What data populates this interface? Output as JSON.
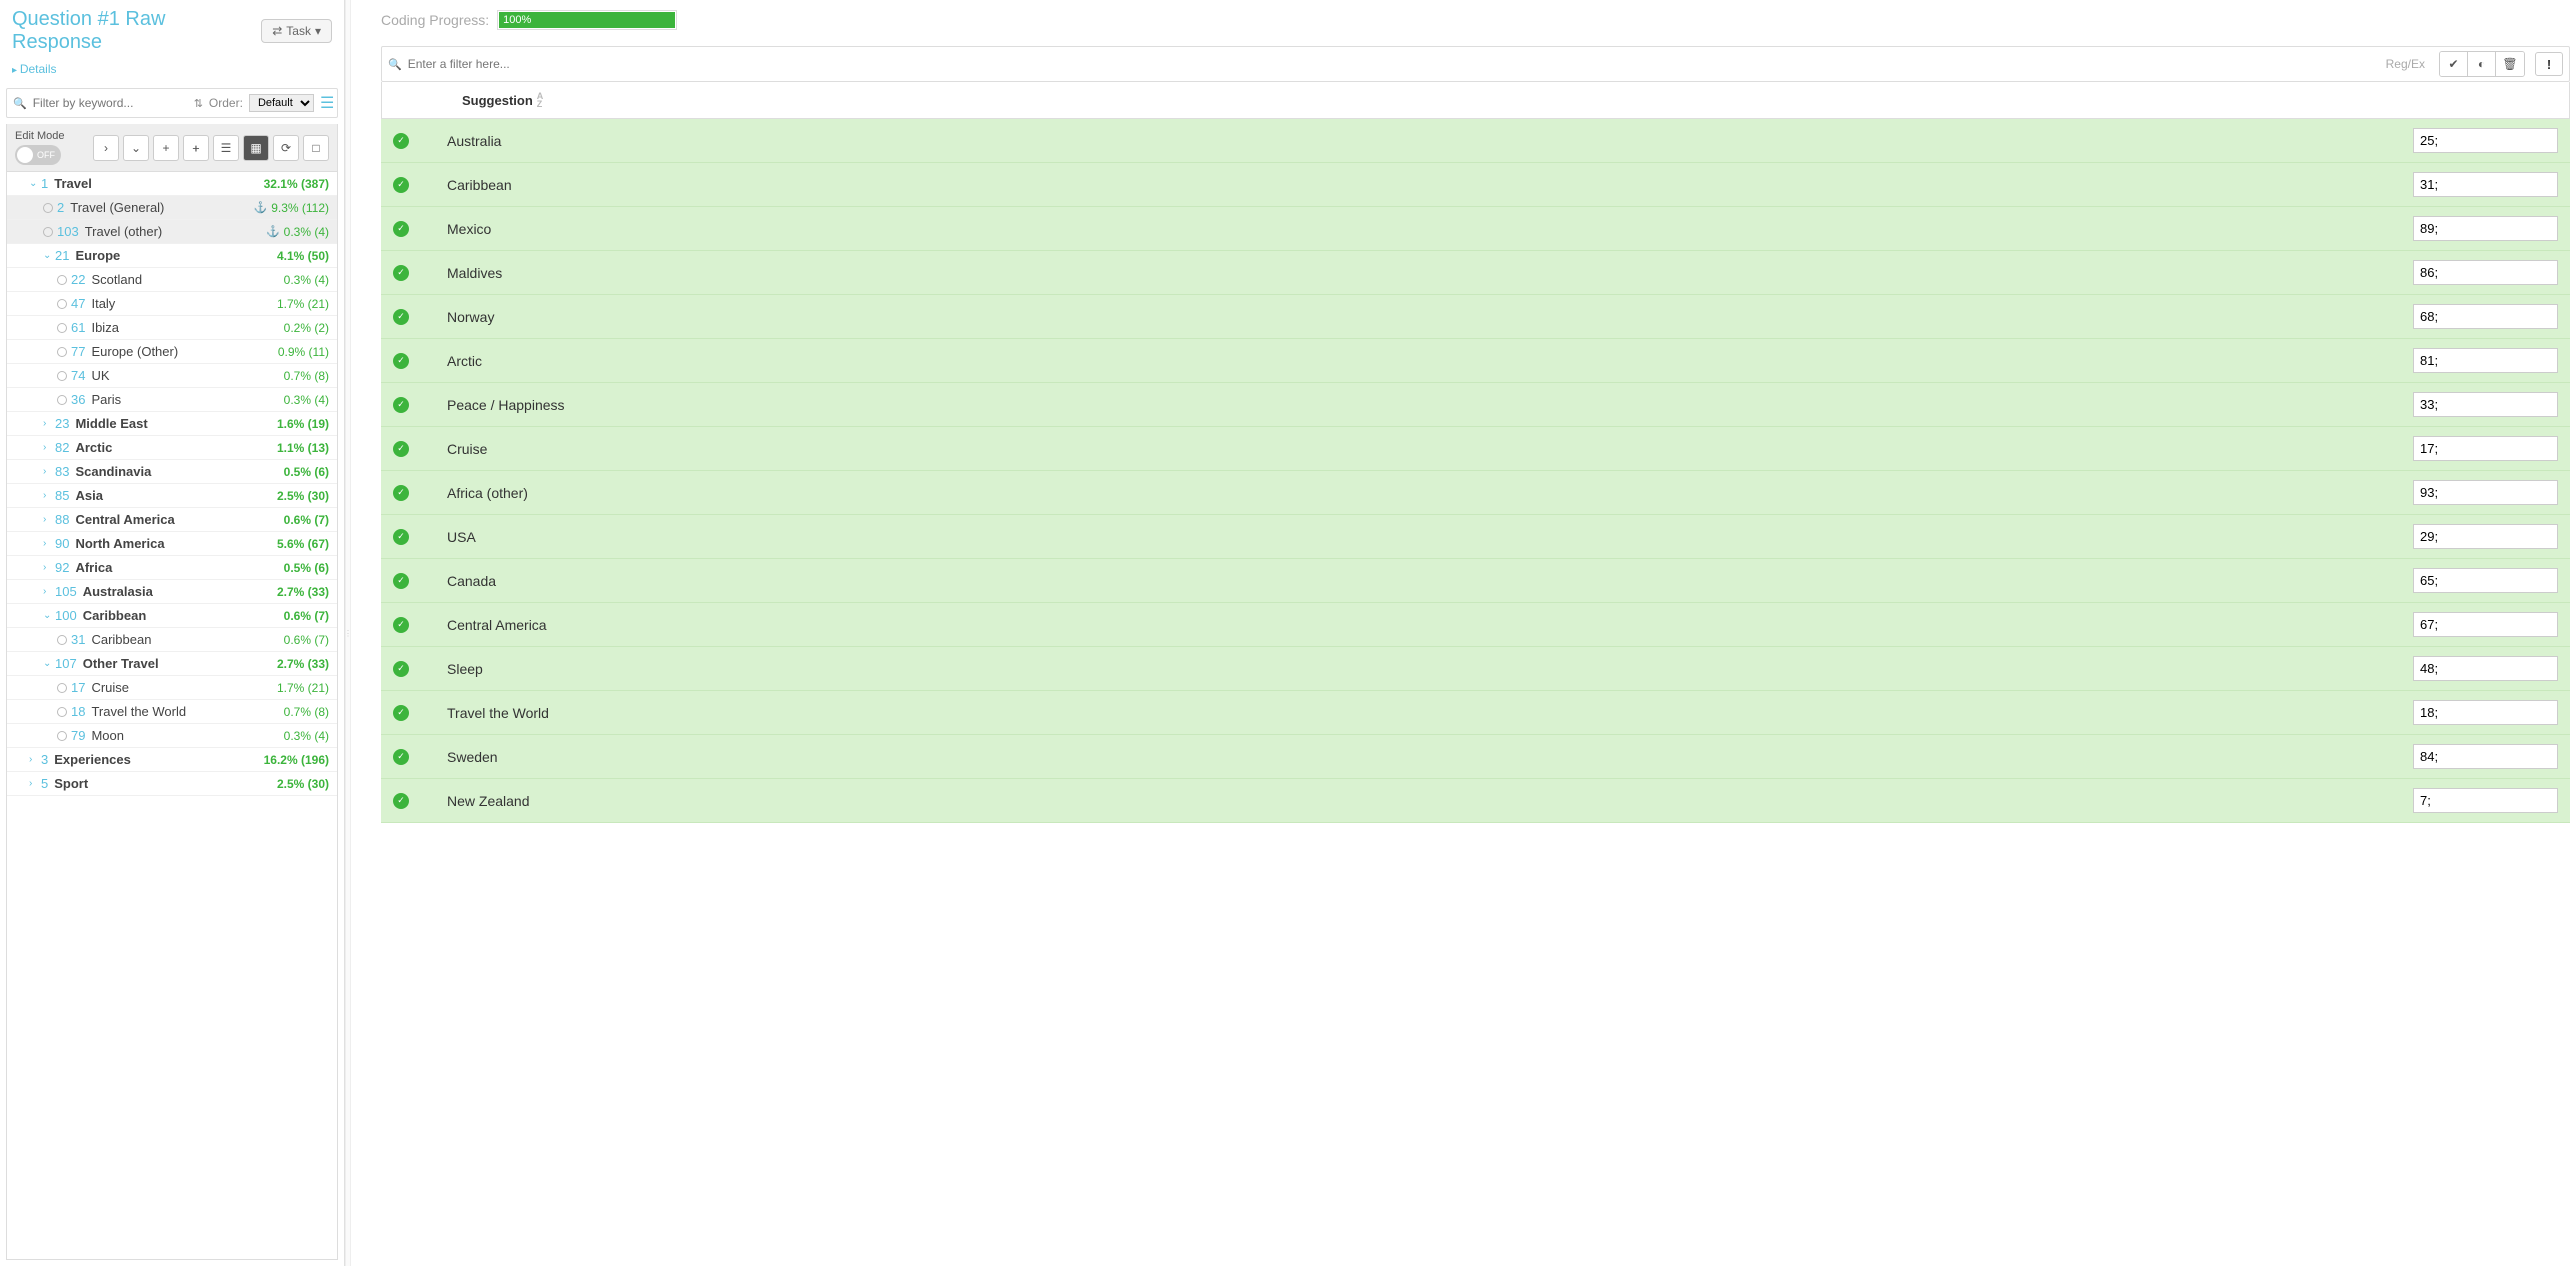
{
  "header": {
    "title": "Question #1 Raw Response",
    "task_button": "Task",
    "details_link": "Details"
  },
  "progress": {
    "label": "Coding Progress:",
    "value": "100%"
  },
  "left_filter": {
    "placeholder": "Filter by keyword...",
    "order_label": "Order:",
    "order_value": "Default"
  },
  "edit_mode": {
    "label": "Edit Mode",
    "state": "OFF"
  },
  "tree": [
    {
      "lvl": 0,
      "caret": "v",
      "num": "1",
      "label": "Travel",
      "stat": "32.1% (387)",
      "bold": true
    },
    {
      "lvl": 1,
      "radio": true,
      "num": "2",
      "label": "Travel (General)",
      "stat": "9.3% (112)",
      "anchor": true,
      "sel": true
    },
    {
      "lvl": 1,
      "radio": true,
      "num": "103",
      "label": "Travel (other)",
      "stat": "0.3% (4)",
      "anchor": true,
      "sel": true
    },
    {
      "lvl": 1,
      "caret": "v",
      "num": "21",
      "label": "Europe",
      "stat": "4.1% (50)",
      "bold": true
    },
    {
      "lvl": 2,
      "radio": true,
      "num": "22",
      "label": "Scotland",
      "stat": "0.3% (4)"
    },
    {
      "lvl": 2,
      "radio": true,
      "num": "47",
      "label": "Italy",
      "stat": "1.7% (21)"
    },
    {
      "lvl": 2,
      "radio": true,
      "num": "61",
      "label": "Ibiza",
      "stat": "0.2% (2)"
    },
    {
      "lvl": 2,
      "radio": true,
      "num": "77",
      "label": "Europe (Other)",
      "stat": "0.9% (11)"
    },
    {
      "lvl": 2,
      "radio": true,
      "num": "74",
      "label": "UK",
      "stat": "0.7% (8)"
    },
    {
      "lvl": 2,
      "radio": true,
      "num": "36",
      "label": "Paris",
      "stat": "0.3% (4)"
    },
    {
      "lvl": 1,
      "caret": ">",
      "num": "23",
      "label": "Middle East",
      "stat": "1.6% (19)",
      "bold": true
    },
    {
      "lvl": 1,
      "caret": ">",
      "num": "82",
      "label": "Arctic",
      "stat": "1.1% (13)",
      "bold": true
    },
    {
      "lvl": 1,
      "caret": ">",
      "num": "83",
      "label": "Scandinavia",
      "stat": "0.5% (6)",
      "bold": true
    },
    {
      "lvl": 1,
      "caret": ">",
      "num": "85",
      "label": "Asia",
      "stat": "2.5% (30)",
      "bold": true
    },
    {
      "lvl": 1,
      "caret": ">",
      "num": "88",
      "label": "Central America",
      "stat": "0.6% (7)",
      "bold": true
    },
    {
      "lvl": 1,
      "caret": ">",
      "num": "90",
      "label": "North America",
      "stat": "5.6% (67)",
      "bold": true
    },
    {
      "lvl": 1,
      "caret": ">",
      "num": "92",
      "label": "Africa",
      "stat": "0.5% (6)",
      "bold": true
    },
    {
      "lvl": 1,
      "caret": ">",
      "num": "105",
      "label": "Australasia",
      "stat": "2.7% (33)",
      "bold": true
    },
    {
      "lvl": 1,
      "caret": "v",
      "num": "100",
      "label": "Caribbean",
      "stat": "0.6% (7)",
      "bold": true
    },
    {
      "lvl": 2,
      "radio": true,
      "num": "31",
      "label": "Caribbean",
      "stat": "0.6% (7)"
    },
    {
      "lvl": 1,
      "caret": "v",
      "num": "107",
      "label": "Other Travel",
      "stat": "2.7% (33)",
      "bold": true
    },
    {
      "lvl": 2,
      "radio": true,
      "num": "17",
      "label": "Cruise",
      "stat": "1.7% (21)"
    },
    {
      "lvl": 2,
      "radio": true,
      "num": "18",
      "label": "Travel the World",
      "stat": "0.7% (8)"
    },
    {
      "lvl": 2,
      "radio": true,
      "num": "79",
      "label": "Moon",
      "stat": "0.3% (4)"
    },
    {
      "lvl": 0,
      "caret": ">",
      "num": "3",
      "label": "Experiences",
      "stat": "16.2% (196)",
      "bold": true
    },
    {
      "lvl": 0,
      "caret": ">",
      "num": "5",
      "label": "Sport",
      "stat": "2.5% (30)",
      "bold": true
    }
  ],
  "right_filter": {
    "placeholder": "Enter a filter here...",
    "regex": "Reg/Ex"
  },
  "suggestion_header": "Suggestion",
  "suggestions": [
    {
      "label": "Australia",
      "val": "25;"
    },
    {
      "label": "Caribbean",
      "val": "31;"
    },
    {
      "label": "Mexico",
      "val": "89;"
    },
    {
      "label": "Maldives",
      "val": "86;"
    },
    {
      "label": "Norway",
      "val": "68;"
    },
    {
      "label": "Arctic",
      "val": "81;"
    },
    {
      "label": "Peace / Happiness",
      "val": "33;"
    },
    {
      "label": "Cruise",
      "val": "17;"
    },
    {
      "label": "Africa (other)",
      "val": "93;"
    },
    {
      "label": "USA",
      "val": "29;"
    },
    {
      "label": "Canada",
      "val": "65;"
    },
    {
      "label": "Central America",
      "val": "67;"
    },
    {
      "label": "Sleep",
      "val": "48;"
    },
    {
      "label": "Travel the World",
      "val": "18;"
    },
    {
      "label": "Sweden",
      "val": "84;"
    },
    {
      "label": "New Zealand",
      "val": "7;"
    }
  ]
}
